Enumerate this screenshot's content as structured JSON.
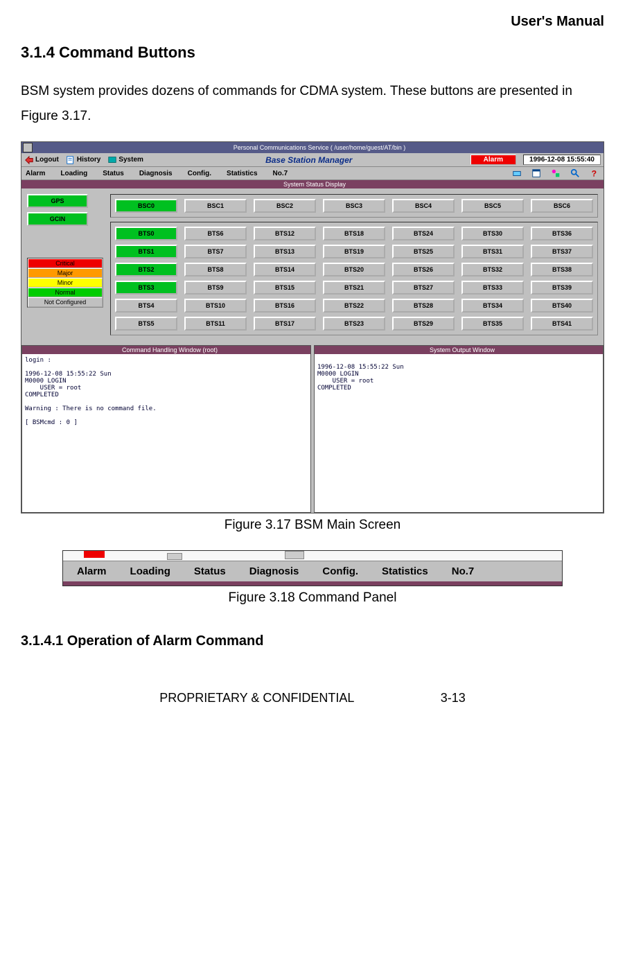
{
  "page": {
    "header": "User's Manual",
    "section_no": "3.1.4",
    "section_title": "Command Buttons",
    "body": "BSM system provides dozens of commands for CDMA system. These buttons are presented in Figure 3.17.",
    "fig1_caption": "Figure 3.17 BSM Main Screen",
    "fig2_caption": "Figure 3.18 Command Panel",
    "subsection": "3.1.4.1 Operation of Alarm Command",
    "footer_left": "PROPRIETARY & CONFIDENTIAL",
    "footer_right": "3-13"
  },
  "app": {
    "window_title": "Personal Communications Service ( /user/home/guest/AT/bin )",
    "toolbar": {
      "logout": "Logout",
      "history": "History",
      "system": "System"
    },
    "bsm_title": "Base Station Manager",
    "alarm": "Alarm",
    "clock": "1996-12-08 15:55:40",
    "menu": [
      "Alarm",
      "Loading",
      "Status",
      "Diagnosis",
      "Config.",
      "Statistics",
      "No.7"
    ],
    "status_title": "System Status Display",
    "left_buttons": [
      "GPS",
      "GCIN"
    ],
    "legend": [
      "Critical",
      "Major",
      "Minor",
      "Normal",
      "Not Configured"
    ],
    "bsc_row": [
      {
        "label": "BSC0",
        "green": true
      },
      {
        "label": "BSC1"
      },
      {
        "label": "BSC2"
      },
      {
        "label": "BSC3"
      },
      {
        "label": "BSC4"
      },
      {
        "label": "BSC5"
      },
      {
        "label": "BSC6"
      }
    ],
    "bts_grid": [
      [
        "BTS0",
        "BTS6",
        "BTS12",
        "BTS18",
        "BTS24",
        "BTS30",
        "BTS36"
      ],
      [
        "BTS1",
        "BTS7",
        "BTS13",
        "BTS19",
        "BTS25",
        "BTS31",
        "BTS37"
      ],
      [
        "BTS2",
        "BTS8",
        "BTS14",
        "BTS20",
        "BTS26",
        "BTS32",
        "BTS38"
      ],
      [
        "BTS3",
        "BTS9",
        "BTS15",
        "BTS21",
        "BTS27",
        "BTS33",
        "BTS39"
      ],
      [
        "BTS4",
        "BTS10",
        "BTS16",
        "BTS22",
        "BTS28",
        "BTS34",
        "BTS40"
      ],
      [
        "BTS5",
        "BTS11",
        "BTS17",
        "BTS23",
        "BTS29",
        "BTS35",
        "BTS41"
      ]
    ],
    "bts_green": [
      "BTS0",
      "BTS1",
      "BTS2",
      "BTS3"
    ],
    "pane1": {
      "title": "Command Handling Window (root)",
      "text": "login :\n\n1996-12-08 15:55:22 Sun\nM0000 LOGIN\n    USER = root\nCOMPLETED\n\nWarning : There is no command file.\n\n[ BSMcmd : 0 ] "
    },
    "pane2": {
      "title": "System Output Window",
      "text": "\n1996-12-08 15:55:22 Sun\nM0000 LOGIN\n    USER = root\nCOMPLETED"
    }
  },
  "cmdpanel": {
    "items": [
      "Alarm",
      "Loading",
      "Status",
      "Diagnosis",
      "Config.",
      "Statistics",
      "No.7"
    ]
  }
}
